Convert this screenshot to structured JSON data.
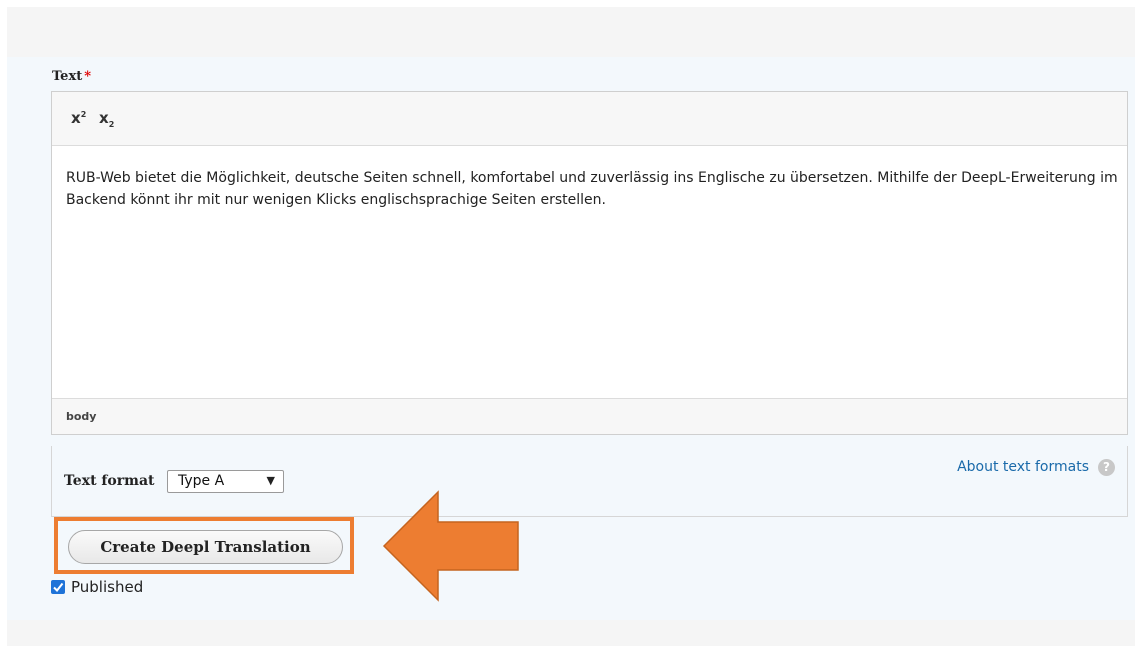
{
  "field": {
    "label": "Text",
    "required_marker": "*"
  },
  "toolbar": {
    "superscript_label": "x",
    "superscript_mark": "2",
    "subscript_label": "x",
    "subscript_mark": "2"
  },
  "editor": {
    "content": "RUB-Web bietet die Möglichkeit, deutsche Seiten schnell, komfortabel und zuverlässig ins Englische zu übersetzen. Mithilfe der DeepL-Erweiterung im Backend könnt ihr mit nur wenigen Klicks englischsprachige Seiten erstellen.",
    "status_path": "body"
  },
  "text_format": {
    "label": "Text format",
    "selected": "Type A",
    "about_link": "About text formats",
    "help_icon": "question-circle-icon"
  },
  "actions": {
    "deepl_button": "Create Deepl Translation"
  },
  "published": {
    "label": "Published",
    "checked": true
  },
  "annotation": {
    "highlight_color": "#ed7d31",
    "arrow_color": "#ed7d31",
    "arrow_icon": "left-arrow-icon"
  }
}
